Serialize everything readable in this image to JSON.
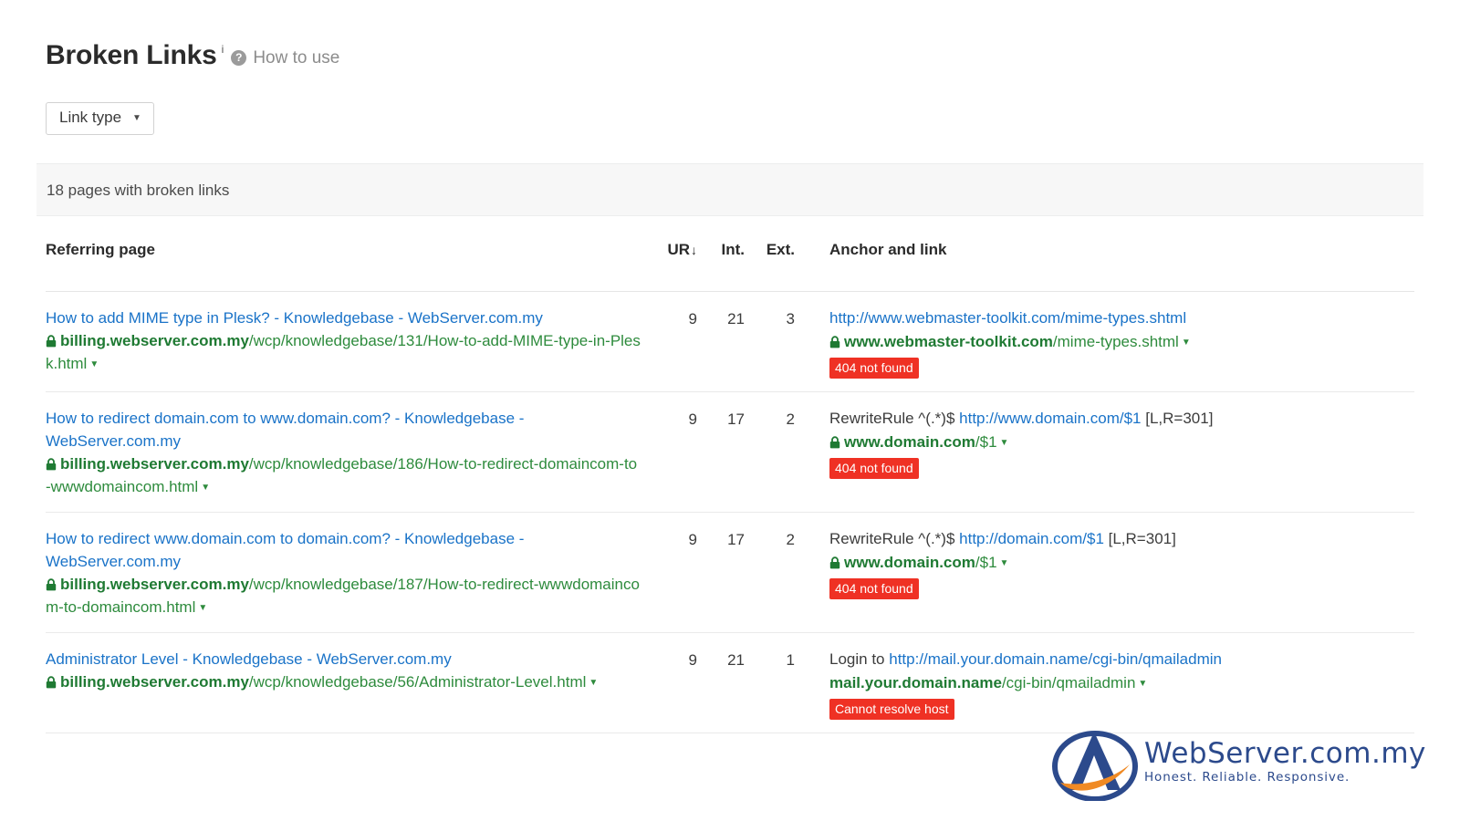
{
  "header": {
    "title": "Broken Links",
    "superscript": "i",
    "help_icon": "?",
    "help_label": "How to use"
  },
  "filters": {
    "link_type_label": "Link type",
    "caret": "▼"
  },
  "summary": {
    "text": "18 pages with broken links"
  },
  "colors": {
    "link": "#1a73c8",
    "url_green": "#2e8b3d",
    "badge_red": "#ef3124",
    "brand_blue": "#2c4a8c",
    "brand_orange": "#f08a24",
    "strip_bg": "#f7f7f7"
  },
  "table": {
    "columns": {
      "referring_page": "Referring page",
      "ur": "UR",
      "ur_sort": "↓",
      "int": "Int.",
      "ext": "Ext.",
      "anchor": "Anchor and link"
    },
    "rows": [
      {
        "title": "How to add MIME type in Plesk? - Knowledgebase - WebServer.com.my",
        "secure": true,
        "url_domain": "billing.webserver.com.my",
        "url_path": "/wcp/knowledgebase/131/How-to-add-MIME-type-in-Plesk.html",
        "url_caret": "▼",
        "ur": "9",
        "int": "21",
        "ext": "3",
        "anchor_prefix": "",
        "anchor_link": "http://www.webmaster-toolkit.com/mime-types.shtml",
        "anchor_suffix": "",
        "target_secure": true,
        "target_domain": "www.webmaster-toolkit.com",
        "target_path": "/mime-types.shtml",
        "target_caret": "▼",
        "status": "404 not found"
      },
      {
        "title": "How to redirect domain.com to www.domain.com? - Knowledgebase - WebServer.com.my",
        "secure": true,
        "url_domain": "billing.webserver.com.my",
        "url_path": "/wcp/knowledgebase/186/How-to-redirect-domaincom-to-wwwdomaincom.html",
        "url_caret": "▼",
        "ur": "9",
        "int": "17",
        "ext": "2",
        "anchor_prefix": "RewriteRule ^(.*)$ ",
        "anchor_link": "http://www.domain.com/$1",
        "anchor_suffix": " [L,R=301]",
        "target_secure": true,
        "target_domain": "www.domain.com",
        "target_path": "/$1",
        "target_caret": "▼",
        "status": "404 not found"
      },
      {
        "title": "How to redirect www.domain.com to domain.com? - Knowledgebase - WebServer.com.my",
        "secure": true,
        "url_domain": "billing.webserver.com.my",
        "url_path": "/wcp/knowledgebase/187/How-to-redirect-wwwdomaincom-to-domaincom.html",
        "url_caret": "▼",
        "ur": "9",
        "int": "17",
        "ext": "2",
        "anchor_prefix": "RewriteRule ^(.*)$ ",
        "anchor_link": "http://domain.com/$1",
        "anchor_suffix": " [L,R=301]",
        "target_secure": true,
        "target_domain": "www.domain.com",
        "target_path": "/$1",
        "target_caret": "▼",
        "status": "404 not found"
      },
      {
        "title": "Administrator Level - Knowledgebase - WebServer.com.my",
        "secure": true,
        "url_domain": "billing.webserver.com.my",
        "url_path": "/wcp/knowledgebase/56/Administrator-Level.html",
        "url_caret": "▼",
        "ur": "9",
        "int": "21",
        "ext": "1",
        "anchor_prefix": "Login to ",
        "anchor_link": "http://mail.your.domain.name/cgi-bin/qmailadmin",
        "anchor_suffix": "",
        "target_secure": false,
        "target_domain": "mail.your.domain.name",
        "target_path": "/cgi-bin/qmailadmin",
        "target_caret": "▼",
        "status": "Cannot resolve host"
      }
    ]
  },
  "brand": {
    "name": "WebServer.com.my",
    "tagline": "Honest. Reliable. Responsive."
  }
}
